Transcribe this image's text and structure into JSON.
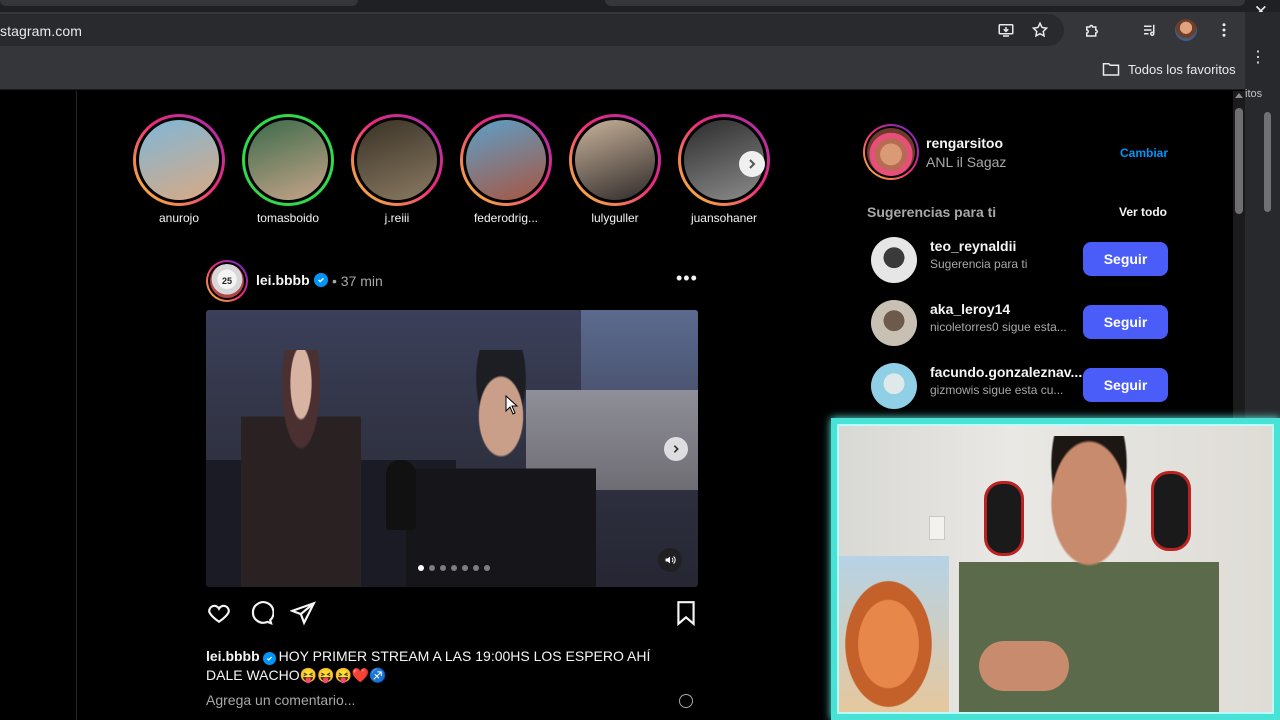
{
  "browser": {
    "url": "stagram.com",
    "bookmark_folder": "Todos los favoritos",
    "side_text": "itos"
  },
  "stories": [
    {
      "username": "anurojo",
      "ring": "gradient",
      "colors": [
        "#7fb7d8",
        "#d9a983"
      ]
    },
    {
      "username": "tomasboido",
      "ring": "green",
      "colors": [
        "#3b6b4a",
        "#c7a48a"
      ]
    },
    {
      "username": "j.reiii",
      "ring": "gradient",
      "colors": [
        "#3a3226",
        "#8a7a62"
      ]
    },
    {
      "username": "federodrig...",
      "ring": "gradient",
      "colors": [
        "#5ca0c9",
        "#a85540"
      ]
    },
    {
      "username": "lulyguller",
      "ring": "gradient",
      "colors": [
        "#c9b39a",
        "#2f2a2a"
      ]
    },
    {
      "username": "juansohaner",
      "ring": "gradient",
      "colors": [
        "#2c2c2c",
        "#8c8c8c"
      ]
    }
  ],
  "post": {
    "username": "lei.bbbb",
    "time": "• 37 min",
    "avatar_text": "25",
    "carousel_count": 7,
    "carousel_active": 0,
    "caption_user": "lei.bbbb",
    "caption_text": "HOY PRIMER STREAM A LAS 19:00HS LOS ESPERO AHÍ DALE WACHO😝😝😝❤️♐",
    "comment_placeholder": "Agrega un comentario..."
  },
  "sidebar": {
    "me_username": "rengarsitoo",
    "me_name": "ANL il Sagaz",
    "switch_label": "Cambiar",
    "suggestions_title": "Sugerencias para ti",
    "see_all": "Ver todo",
    "suggestions": [
      {
        "username": "teo_reynaldii",
        "sub": "Sugerencia para ti",
        "follow": "Seguir",
        "colors": [
          "#e6e6e6",
          "#3a3a3a"
        ]
      },
      {
        "username": "aka_leroy14",
        "sub": "nicoletorres0 sigue esta...",
        "follow": "Seguir",
        "colors": [
          "#c8c1b3",
          "#6d5a4a"
        ]
      },
      {
        "username": "facundo.gonzaleznav...",
        "sub": "gizmowis sigue esta cu...",
        "follow": "Seguir",
        "colors": [
          "#8fd0e6",
          "#dfe9ea"
        ]
      }
    ]
  },
  "colors": {
    "accent": "#0095f6",
    "follow_button": "#4a5df9",
    "webcam_border": "#48e2d6"
  }
}
